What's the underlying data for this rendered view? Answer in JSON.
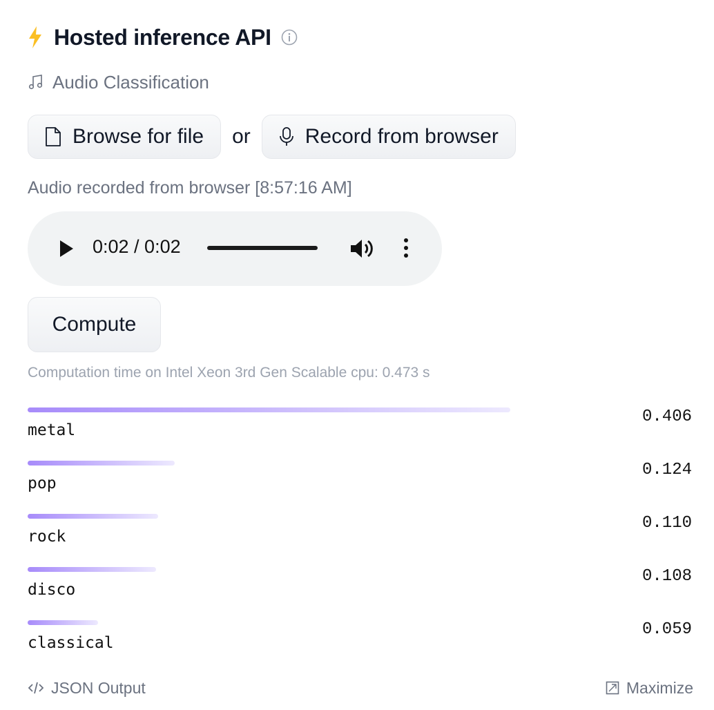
{
  "header": {
    "title": "Hosted inference API"
  },
  "task": {
    "label": "Audio Classification"
  },
  "inputs": {
    "browse_label": "Browse for file",
    "or_label": "or",
    "record_label": "Record from browser"
  },
  "recording": {
    "caption": "Audio recorded from browser [8:57:16 AM]"
  },
  "player": {
    "time": "0:02 / 0:02",
    "progress": 1.0
  },
  "compute": {
    "button_label": "Compute",
    "time_text": "Computation time on Intel Xeon 3rd Gen Scalable cpu: 0.473 s"
  },
  "results": [
    {
      "label": "metal",
      "score": "0.406",
      "value": 0.406
    },
    {
      "label": "pop",
      "score": "0.124",
      "value": 0.124
    },
    {
      "label": "rock",
      "score": "0.110",
      "value": 0.11
    },
    {
      "label": "disco",
      "score": "0.108",
      "value": 0.108
    },
    {
      "label": "classical",
      "score": "0.059",
      "value": 0.059
    }
  ],
  "footer": {
    "json_label": "JSON Output",
    "maximize_label": "Maximize"
  },
  "colors": {
    "accent": "#fbbf24",
    "bar_start": "#a78bfa",
    "bar_end": "#ede9fe"
  }
}
